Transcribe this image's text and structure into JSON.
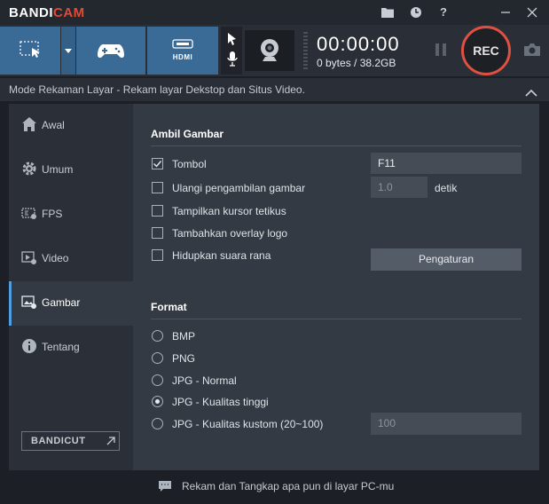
{
  "app": {
    "logo_main": "BANDI",
    "logo_accent": "CAM"
  },
  "titlebar": {
    "icons": [
      "folder-icon",
      "clock-icon",
      "help-icon",
      "minimize-icon",
      "close-icon"
    ],
    "help_label": "?"
  },
  "toolbar": {
    "timer": "00:00:00",
    "file_size": "0 bytes / 38.2GB",
    "rec_label": "REC",
    "hdmi_label": "HDMI"
  },
  "mode_bar": {
    "text": "Mode Rekaman Layar - Rekam layar Dekstop dan Situs Video."
  },
  "sidebar": {
    "items": [
      {
        "label": "Awal",
        "icon": "home-icon"
      },
      {
        "label": "Umum",
        "icon": "gear-icon"
      },
      {
        "label": "FPS",
        "icon": "fps-icon"
      },
      {
        "label": "Video",
        "icon": "video-settings-icon"
      },
      {
        "label": "Gambar",
        "icon": "image-settings-icon"
      },
      {
        "label": "Tentang",
        "icon": "info-icon"
      }
    ],
    "active_index": 4,
    "bandicut_label": "BANDICUT"
  },
  "capture": {
    "title": "Ambil Gambar",
    "options": [
      {
        "label": "Tombol",
        "checked": true
      },
      {
        "label": "Ulangi pengambilan gambar",
        "checked": false
      },
      {
        "label": "Tampilkan kursor tetikus",
        "checked": false
      },
      {
        "label": "Tambahkan overlay logo",
        "checked": false
      },
      {
        "label": "Hidupkan suara rana",
        "checked": false
      }
    ],
    "hotkey": "F11",
    "repeat_value": "1.0",
    "repeat_unit": "detik",
    "settings_button": "Pengaturan"
  },
  "format": {
    "title": "Format",
    "options": [
      {
        "label": "BMP",
        "selected": false
      },
      {
        "label": "PNG",
        "selected": false
      },
      {
        "label": "JPG - Normal",
        "selected": false
      },
      {
        "label": "JPG - Kualitas tinggi",
        "selected": true
      },
      {
        "label": "JPG - Kualitas kustom (20~100)",
        "selected": false
      }
    ],
    "custom_quality": "100"
  },
  "footer": {
    "text": "Rekam dan Tangkap apa pun di layar PC-mu"
  },
  "colors": {
    "accent": "#3a6a96",
    "rec": "#e05040",
    "active_bar": "#4f9ee0"
  }
}
